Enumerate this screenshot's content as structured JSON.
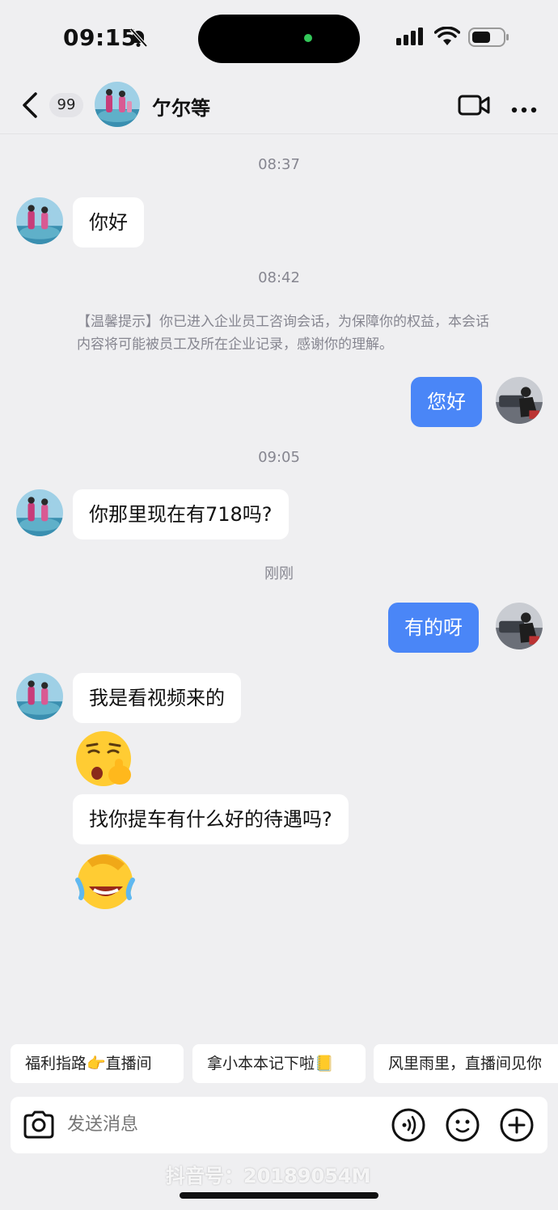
{
  "status": {
    "time": "09:15"
  },
  "header": {
    "unread_count": "99",
    "title": "亇尔等"
  },
  "messages": {
    "t1": "08:37",
    "m1": "你好",
    "t2": "08:42",
    "notice": "【温馨提示】你已进入企业员工咨询会话，为保障你的权益，本会话内容将可能被员工及所在企业记录，感谢你的理解。",
    "m2": "您好",
    "t3": "09:05",
    "m3": "你那里现在有718吗?",
    "t4": "刚刚",
    "m4": "有的呀",
    "m5": "我是看视频来的",
    "m6_emoji": "shush-emoji",
    "m7": "找你提车有什么好的待遇吗?",
    "m8_emoji": "laughing-crying-emoji"
  },
  "quick_replies": [
    "福利指路👉直播间",
    "拿小本本记下啦📒",
    "风里雨里，直播间见你"
  ],
  "input": {
    "placeholder": "发送消息"
  },
  "watermark": "抖音号：20189054M",
  "colors": {
    "sent_bubble": "#4a86f7",
    "background": "#efeff1"
  }
}
